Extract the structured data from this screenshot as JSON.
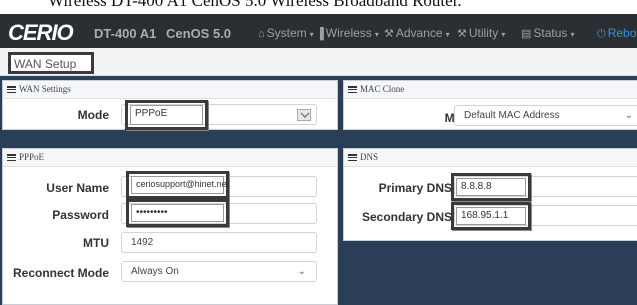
{
  "caption": "Wireless DT-400 A1 CenOS 5.0 Wireless Broadband Router.",
  "header": {
    "brand": "CERIO",
    "model": "DT-400 A1",
    "os": "CenOS 5.0",
    "menu": [
      {
        "icon": "home-icon",
        "glyph": "⌂",
        "label": "System"
      },
      {
        "icon": "signal-icon",
        "glyph": "▐",
        "label": "Wireless"
      },
      {
        "icon": "wrench-icon",
        "glyph": "⚒",
        "label": "Advance"
      },
      {
        "icon": "wrench-icon",
        "glyph": "⚒",
        "label": "Utility"
      },
      {
        "icon": "chart-icon",
        "glyph": "▤",
        "label": "Status"
      },
      {
        "icon": "power-icon",
        "glyph": "⏻",
        "label": "Reboot"
      }
    ]
  },
  "breadcrumb": "WAN Setup",
  "wan_settings": {
    "title": "WAN Settings",
    "mode_label": "Mode",
    "mode_value": "PPPoE"
  },
  "mac_clone": {
    "title": "MAC Clone",
    "mode_label": "Mode",
    "mode_value": "Default MAC Address"
  },
  "pppoe": {
    "title": "PPPoE",
    "username_label": "User Name",
    "username_value": "ceriosupport@hinet.net",
    "password_label": "Password",
    "password_value": "•••••••••",
    "mtu_label": "MTU",
    "mtu_value": "1492",
    "reconnect_label": "Reconnect Mode",
    "reconnect_value": "Always On"
  },
  "dns": {
    "title": "DNS",
    "primary_label": "Primary DNS",
    "primary_value": "8.8.8.8",
    "secondary_label": "Secondary DNS",
    "secondary_value": "168.95.1.1"
  },
  "colors": {
    "topbar": "#2b2f33",
    "content_bg": "#2a3f57",
    "accent": "#3a8fd9"
  }
}
